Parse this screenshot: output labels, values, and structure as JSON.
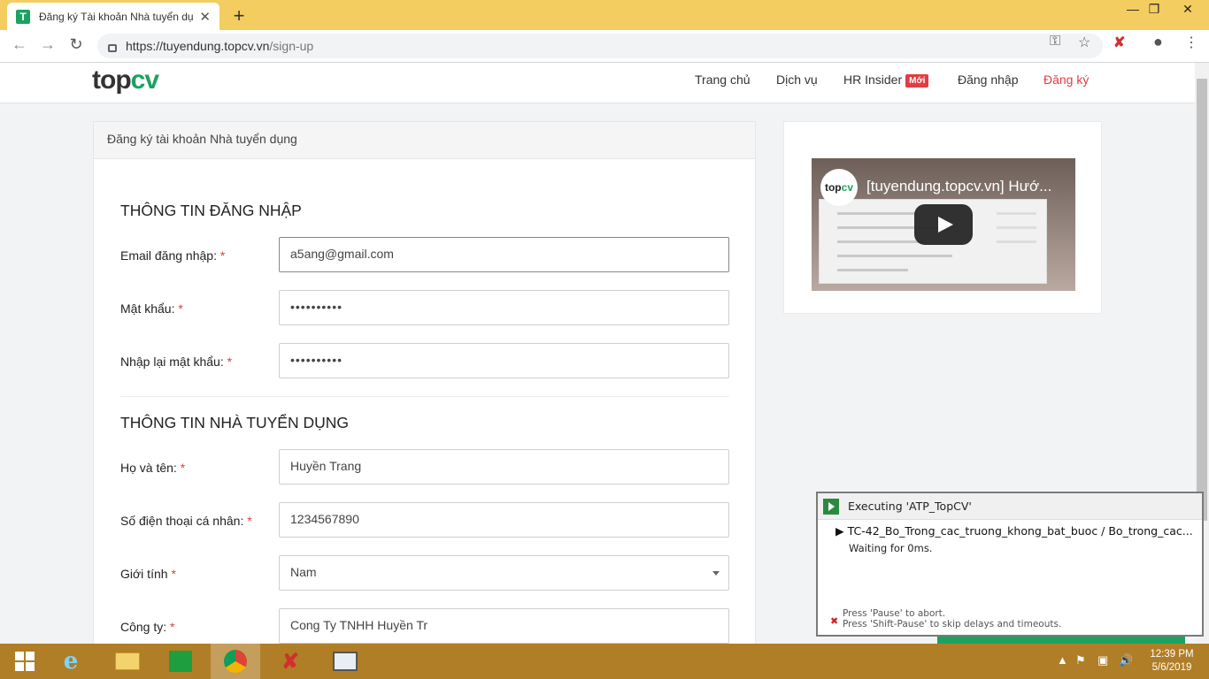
{
  "browser": {
    "tab_title": "Đăng ký Tài khoản Nhà tuyển dụ",
    "tab_favicon": "T",
    "new_tab": "+",
    "url_prefix": "https://tuyendung.topcv.vn",
    "url_path": "/sign-up",
    "window_controls": {
      "minimize": "—",
      "restore": "❐",
      "close": "✕"
    }
  },
  "site": {
    "logo_part1": "top",
    "logo_part2": "cv",
    "nav": {
      "home": "Trang chủ",
      "services": "Dịch vụ",
      "hr_insider": "HR Insider",
      "hr_badge": "Mới",
      "login": "Đăng nhập",
      "signup": "Đăng ký"
    },
    "brand_color": "#1ba261",
    "accent_color": "#e23c44"
  },
  "form": {
    "card_title": "Đăng ký tài khoản Nhà tuyển dụng",
    "section_login": "THÔNG TIN ĐĂNG NHẬP",
    "section_employer": "THÔNG TIN NHÀ TUYỂN DỤNG",
    "required_mark": "*",
    "email_label": "Email đăng nhập:",
    "email_value": "a5ang@gmail.com",
    "password_label": "Mật khẩu:",
    "password_value": "••••••••••",
    "password_confirm_label": "Nhập lại mật khẩu:",
    "password_confirm_value": "••••••••••",
    "fullname_label": "Họ và tên:",
    "fullname_value": "Huyền Trang",
    "phone_label": "Số điện thoại cá nhân:",
    "phone_value": "1234567890",
    "gender_label": "Giới tính",
    "gender_value": "Nam",
    "company_label": "Công ty:",
    "company_value": "Cong Ty TNHH Huyền Tr"
  },
  "video": {
    "logo_part1": "top",
    "logo_part2": "cv",
    "title": "[tuyendung.topcv.vn] Hướ..."
  },
  "katalon": {
    "header": "Executing 'ATP_TopCV'",
    "test_case": "TC-42_Bo_Trong_cac_truong_khong_bat_buoc  /  Bo_trong_cac...",
    "status": "Waiting for 0ms.",
    "hint1": "Press 'Pause' to abort.",
    "hint2": "Press 'Shift-Pause' to skip delays and timeouts."
  },
  "taskbar": {
    "time": "12:39 PM",
    "date": "5/6/2019"
  }
}
